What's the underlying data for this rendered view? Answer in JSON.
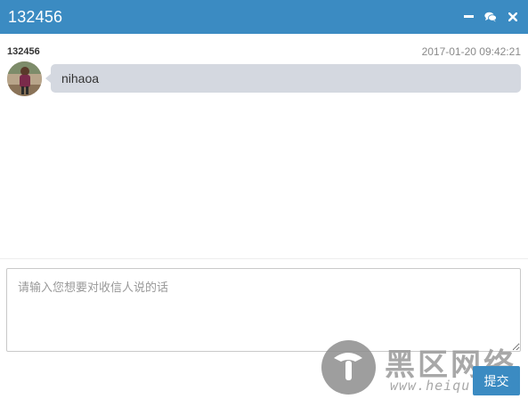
{
  "window": {
    "title": "132456",
    "controls": [
      {
        "name": "minimize-icon"
      },
      {
        "name": "chat-icon"
      },
      {
        "name": "close-icon"
      }
    ]
  },
  "messages": [
    {
      "sender": "132456",
      "timestamp": "2017-01-20 09:42:21",
      "text": "nihaoa",
      "avatar": "user-avatar"
    }
  ],
  "composer": {
    "placeholder": "请输入您想要对收信人说的话",
    "value": ""
  },
  "actions": {
    "submit_label": "提交"
  },
  "watermark": {
    "title": "黑区网络",
    "url": "www.heiqu.com"
  },
  "colors": {
    "accent": "#3b8bc2",
    "bubble": "#d4d8e0"
  }
}
